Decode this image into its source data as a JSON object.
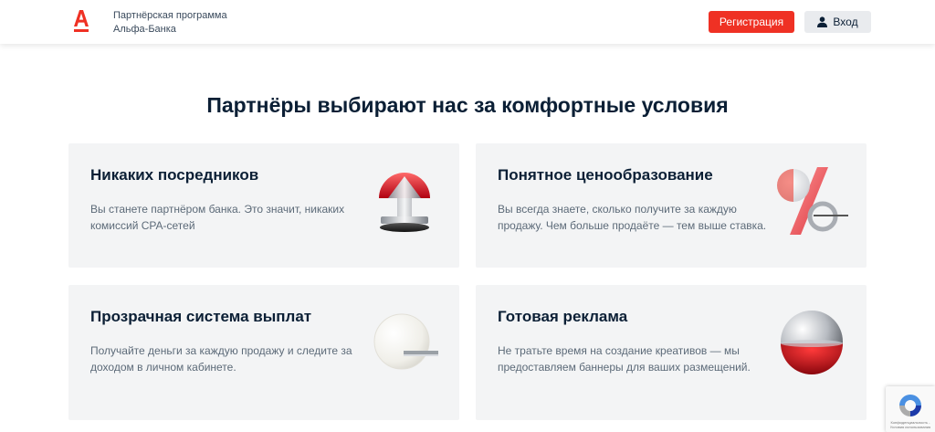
{
  "header": {
    "brand_line1": "Партнёрская программа",
    "brand_line2": "Альфа-Банка",
    "register_label": "Регистрация",
    "login_label": "Вход"
  },
  "main": {
    "heading": "Партнёры выбирают нас за комфортные условия",
    "cards": [
      {
        "title": "Никаких посредников",
        "text": "Вы станете партнёром банка. Это значит, никаких комиссий CPA-сетей",
        "icon": "arrow-up-icon"
      },
      {
        "title": "Понятное ценообразование",
        "text": "Вы всегда знаете, сколько получите за каждую продажу. Чем больше продаёте — тем выше ставка.",
        "icon": "percent-icon"
      },
      {
        "title": "Прозрачная система выплат",
        "text": "Получайте деньги за каждую продажу и следите за доходом в личном кабинете.",
        "icon": "glass-disc-icon"
      },
      {
        "title": "Готовая реклама",
        "text": "Не тратьте время на создание креативов — мы предоставляем баннеры для ваших размещений.",
        "icon": "sphere-icon"
      }
    ]
  },
  "recaptcha": {
    "text": "Конфиденциальность - Условия использования"
  },
  "colors": {
    "accent": "#ef3124",
    "text": "#0b1f35",
    "muted": "#5c6a78",
    "card_bg": "#f3f4f5"
  }
}
